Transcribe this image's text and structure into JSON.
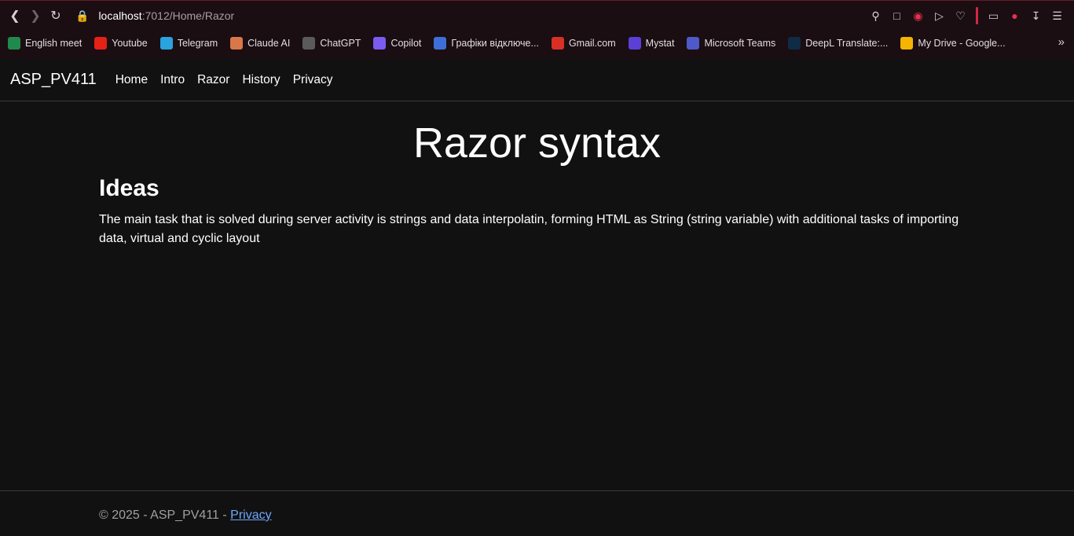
{
  "browser": {
    "url_host": "localhost",
    "url_path": ":7012/Home/Razor",
    "bookmarks": [
      {
        "label": "English meet",
        "icon": "google-meet-icon",
        "color": "#1f8a4c"
      },
      {
        "label": "Youtube",
        "icon": "youtube-icon",
        "color": "#e62117"
      },
      {
        "label": "Telegram",
        "icon": "telegram-icon",
        "color": "#2aa3df"
      },
      {
        "label": "Claude AI",
        "icon": "claude-icon",
        "color": "#d9774b"
      },
      {
        "label": "ChatGPT",
        "icon": "chatgpt-icon",
        "color": "#5a5a5a"
      },
      {
        "label": "Copilot",
        "icon": "copilot-icon",
        "color": "#7b5cf0"
      },
      {
        "label": "Графіки відключе...",
        "icon": "power-icon",
        "color": "#3e6fd8"
      },
      {
        "label": "Gmail.com",
        "icon": "gmail-icon",
        "color": "#d93025"
      },
      {
        "label": "Mystat",
        "icon": "mystat-icon",
        "color": "#5b3fd6"
      },
      {
        "label": "Microsoft Teams",
        "icon": "teams-icon",
        "color": "#5059c9"
      },
      {
        "label": "DeepL Translate:...",
        "icon": "deepl-icon",
        "color": "#0f2b46"
      },
      {
        "label": "My Drive - Google...",
        "icon": "google-drive-icon",
        "color": "#f4b400"
      }
    ]
  },
  "navbar": {
    "brand": "ASP_PV411",
    "links": [
      "Home",
      "Intro",
      "Razor",
      "History",
      "Privacy"
    ]
  },
  "main": {
    "title": "Razor syntax",
    "heading": "Ideas",
    "paragraph": "The main task that is solved during server activity is strings and data interpolatin, forming HTML as String (string variable) with additional tasks of importing data, virtual and cyclic layout"
  },
  "footer": {
    "text": "© 2025 - ASP_PV411 - ",
    "link": "Privacy"
  }
}
